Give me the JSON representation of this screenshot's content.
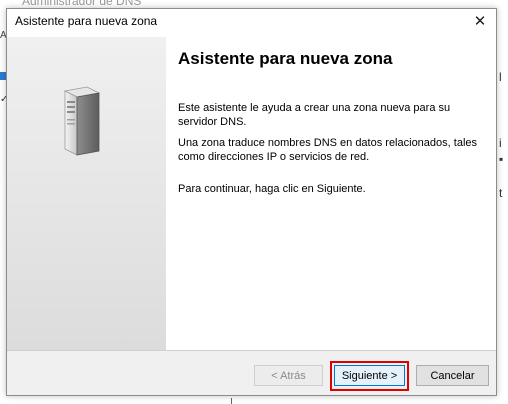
{
  "background": {
    "window_title": "Administrador de DNS"
  },
  "dialog": {
    "title": "Asistente para nueva zona",
    "close_glyph": "✕",
    "heading": "Asistente para nueva zona",
    "paragraphs": [
      "Este asistente le ayuda a crear una zona nueva para su servidor DNS.",
      "Una zona traduce nombres DNS en datos relacionados, tales como direcciones IP o servicios de red.",
      "Para continuar, haga clic en Siguiente."
    ],
    "sidebar_icon": "server-icon"
  },
  "buttons": {
    "back": "< Atrás",
    "next": "Siguiente >",
    "cancel": "Cancelar"
  },
  "colors": {
    "highlight": "#e00000",
    "default_button_border": "#0078d7"
  }
}
